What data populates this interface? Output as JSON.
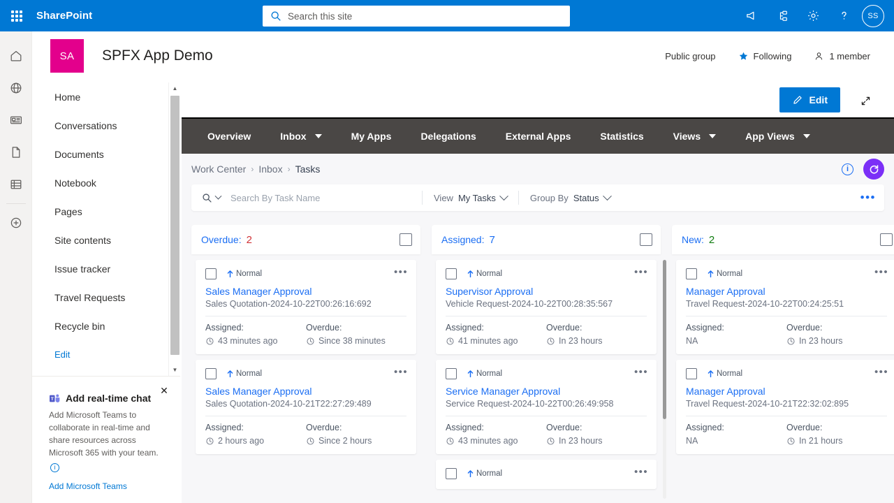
{
  "suite": {
    "brand": "SharePoint",
    "waffle_icon": "app-launcher-icon",
    "search": {
      "placeholder": "Search this site",
      "value": "",
      "icon": "search-icon"
    },
    "icons": [
      {
        "name": "megaphone-icon",
        "label": "Announcements"
      },
      {
        "name": "diagram-icon",
        "label": "Org"
      },
      {
        "name": "gear-icon",
        "label": "Settings"
      },
      {
        "name": "help-icon",
        "label": "Help"
      }
    ],
    "avatar_initials": "SS"
  },
  "rail": {
    "items": [
      {
        "name": "home-icon",
        "label": "Home"
      },
      {
        "name": "globe-icon",
        "label": "Sites"
      },
      {
        "name": "news-icon",
        "label": "News"
      },
      {
        "name": "document-icon",
        "label": "Files"
      },
      {
        "name": "lists-icon",
        "label": "Lists"
      },
      {
        "name": "plus-icon",
        "label": "Create"
      }
    ]
  },
  "site": {
    "logo_initials": "SA",
    "logo_color": "#e3008c",
    "title": "SPFX App Demo",
    "privacy": "Public group",
    "following": "Following",
    "members": "1 member",
    "star_icon": "star-filled-icon",
    "people_icon": "people-icon"
  },
  "edit_bar": {
    "edit_label": "Edit",
    "pencil_icon": "pencil-icon",
    "expand_icon": "expand-diagonal-icon",
    "accent": "#0078d4"
  },
  "leftnav": {
    "items": [
      {
        "label": "Home"
      },
      {
        "label": "Conversations"
      },
      {
        "label": "Documents"
      },
      {
        "label": "Notebook"
      },
      {
        "label": "Pages"
      },
      {
        "label": "Site contents"
      },
      {
        "label": "Issue tracker"
      },
      {
        "label": "Travel Requests"
      },
      {
        "label": "Recycle bin"
      }
    ],
    "edit_label": "Edit",
    "scroll_up_icon": "caret-up-icon",
    "scroll_down_icon": "caret-down-icon"
  },
  "teams_promo": {
    "close_icon": "close-icon",
    "teams_icon": "microsoft-teams-icon",
    "title": "Add real-time chat",
    "body": "Add Microsoft Teams to collaborate in real-time and share resources across Microsoft 365 with your team.",
    "info_icon": "info-icon",
    "link": "Add Microsoft Teams"
  },
  "app": {
    "nav_tabs": [
      {
        "label": "Overview",
        "has_caret": false
      },
      {
        "label": "Inbox",
        "has_caret": true
      },
      {
        "label": "My Apps",
        "has_caret": false
      },
      {
        "label": "Delegations",
        "has_caret": false
      },
      {
        "label": "External Apps",
        "has_caret": false
      },
      {
        "label": "Statistics",
        "has_caret": false
      },
      {
        "label": "Views",
        "has_caret": true
      },
      {
        "label": "App Views",
        "has_caret": true
      }
    ],
    "nav_bg": "#4a4745",
    "breadcrumb": [
      {
        "label": "Work Center",
        "active": false
      },
      {
        "label": "Inbox",
        "active": false
      },
      {
        "label": "Tasks",
        "active": true
      }
    ],
    "breadcrumb_sep": "›",
    "info_icon": "info-circle-icon",
    "refresh_icon": "refresh-icon",
    "refresh_color": "#7b2ff7",
    "toolbar": {
      "search_icon": "search-icon",
      "search_placeholder": "Search By Task Name",
      "search_value": "",
      "view_label": "View",
      "view_value": "My Tasks",
      "groupby_label": "Group By",
      "groupby_value": "Status",
      "more_icon": "ellipsis-icon"
    },
    "columns": [
      {
        "name": "Overdue:",
        "count": "2",
        "count_color": "#d13438",
        "cards": [
          {
            "priority": "Normal",
            "priority_icon": "arrow-up-icon",
            "title": "Sales Manager Approval",
            "subtitle": "Sales Quotation-2024-10-22T00:26:16:692",
            "assigned_label": "Assigned:",
            "assigned_value": "43 minutes ago",
            "assigned_has_clock": true,
            "overdue_label": "Overdue:",
            "overdue_value": "Since 38 minutes",
            "overdue_has_clock": true
          },
          {
            "priority": "Normal",
            "priority_icon": "arrow-up-icon",
            "title": "Sales Manager Approval",
            "subtitle": "Sales Quotation-2024-10-21T22:27:29:489",
            "assigned_label": "Assigned:",
            "assigned_value": "2 hours ago",
            "assigned_has_clock": true,
            "overdue_label": "Overdue:",
            "overdue_value": "Since 2 hours",
            "overdue_has_clock": true
          }
        ]
      },
      {
        "name": "Assigned:",
        "count": "7",
        "count_color": "#1b6ef3",
        "cards": [
          {
            "priority": "Normal",
            "priority_icon": "arrow-up-icon",
            "title": "Supervisor Approval",
            "subtitle": "Vehicle Request-2024-10-22T00:28:35:567",
            "assigned_label": "Assigned:",
            "assigned_value": "41 minutes ago",
            "assigned_has_clock": true,
            "overdue_label": "Overdue:",
            "overdue_value": "In 23 hours",
            "overdue_has_clock": true
          },
          {
            "priority": "Normal",
            "priority_icon": "arrow-up-icon",
            "title": "Service Manager Approval",
            "subtitle": "Service Request-2024-10-22T00:26:49:958",
            "assigned_label": "Assigned:",
            "assigned_value": "43 minutes ago",
            "assigned_has_clock": true,
            "overdue_label": "Overdue:",
            "overdue_value": "In 23 hours",
            "overdue_has_clock": true
          },
          {
            "priority": "Normal",
            "priority_icon": "arrow-up-icon",
            "title": "",
            "subtitle": "",
            "assigned_label": "",
            "assigned_value": "",
            "assigned_has_clock": false,
            "overdue_label": "",
            "overdue_value": "",
            "overdue_has_clock": false
          }
        ]
      },
      {
        "name": "New:",
        "count": "2",
        "count_color": "#107c10",
        "cards": [
          {
            "priority": "Normal",
            "priority_icon": "arrow-up-icon",
            "title": "Manager Approval",
            "subtitle": "Travel Request-2024-10-22T00:24:25:51",
            "assigned_label": "Assigned:",
            "assigned_value": "NA",
            "assigned_has_clock": false,
            "overdue_label": "Overdue:",
            "overdue_value": "In 23 hours",
            "overdue_has_clock": true
          },
          {
            "priority": "Normal",
            "priority_icon": "arrow-up-icon",
            "title": "Manager Approval",
            "subtitle": "Travel Request-2024-10-21T22:32:02:895",
            "assigned_label": "Assigned:",
            "assigned_value": "NA",
            "assigned_has_clock": false,
            "overdue_label": "Overdue:",
            "overdue_value": "In 21 hours",
            "overdue_has_clock": true
          }
        ]
      }
    ]
  }
}
